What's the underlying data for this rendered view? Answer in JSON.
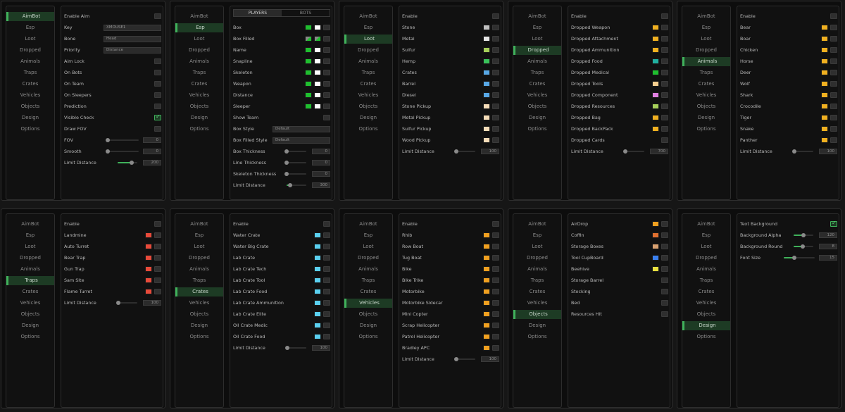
{
  "nav_labels": [
    "AimBot",
    "Esp",
    "Loot",
    "Dropped",
    "Animals",
    "Traps",
    "Crates",
    "Vehicles",
    "Objects",
    "Design",
    "Options"
  ],
  "esp_tabs": [
    "PLAYERS",
    "BOTS"
  ],
  "colors": {
    "accent": "#3fb25a",
    "bg": "#0d0d0d",
    "panel": "#111111"
  },
  "windows": [
    {
      "active": 0,
      "rows": [
        {
          "t": "check",
          "label": "Enable Aim",
          "on": false
        },
        {
          "t": "field",
          "label": "Key",
          "value": "XMOUSE1"
        },
        {
          "t": "field",
          "label": "Bone",
          "value": "Head"
        },
        {
          "t": "field",
          "label": "Priority",
          "value": "Distance"
        },
        {
          "t": "check",
          "label": "Aim Lock",
          "on": false
        },
        {
          "t": "check",
          "label": "On Bots",
          "on": false
        },
        {
          "t": "check",
          "label": "On Team",
          "on": false
        },
        {
          "t": "check",
          "label": "On Sleepers",
          "on": false
        },
        {
          "t": "check",
          "label": "Prediction",
          "on": false
        },
        {
          "t": "check",
          "label": "Visible Check",
          "on": true
        },
        {
          "t": "check",
          "label": "Draw FOV",
          "on": false
        },
        {
          "t": "slider",
          "label": "FOV",
          "value": "0",
          "pct": 0
        },
        {
          "t": "slider",
          "label": "Smooth",
          "value": "0",
          "pct": 0
        },
        {
          "t": "slider",
          "label": "Limit Distance",
          "value": "200",
          "pct": 0.72
        }
      ]
    },
    {
      "active": 1,
      "tabs": true,
      "rows": [
        {
          "t": "esp",
          "label": "Box",
          "colors": [
            "#1fbf2f",
            "#ffffff"
          ]
        },
        {
          "t": "esp",
          "label": "Box Filled",
          "colors": [
            "mixed",
            "mixed"
          ]
        },
        {
          "t": "esp",
          "label": "Name",
          "colors": [
            "#1fbf2f",
            "#ffffff"
          ]
        },
        {
          "t": "esp",
          "label": "Snapline",
          "colors": [
            "#1fbf2f",
            "#ffffff"
          ]
        },
        {
          "t": "esp",
          "label": "Skeleton",
          "colors": [
            "#1fbf2f",
            "#ffffff"
          ]
        },
        {
          "t": "esp",
          "label": "Weapon",
          "colors": [
            "#1fbf2f",
            "#ffffff"
          ]
        },
        {
          "t": "esp",
          "label": "Distance",
          "colors": [
            "#1fbf2f",
            "#ffffff"
          ]
        },
        {
          "t": "esp",
          "label": "Sleeper",
          "colors": [
            "#1fbf2f",
            "#ffffff"
          ]
        },
        {
          "t": "check",
          "label": "Show Team",
          "on": false
        },
        {
          "t": "field",
          "label": "Box Style",
          "value": "Default"
        },
        {
          "t": "field",
          "label": "Box Filled Style",
          "value": "Default"
        },
        {
          "t": "slider",
          "label": "Box Thickness",
          "value": "0",
          "pct": 0
        },
        {
          "t": "slider",
          "label": "Line Thickness",
          "value": "0",
          "pct": 0
        },
        {
          "t": "slider",
          "label": "Skeleton Thickness",
          "value": "0",
          "pct": 0
        },
        {
          "t": "slider",
          "label": "Limit Distance",
          "value": "300",
          "pct": 0.18
        }
      ]
    },
    {
      "active": 2,
      "rows": [
        {
          "t": "check",
          "label": "Enable",
          "on": false
        },
        {
          "t": "color",
          "label": "Stone",
          "color": "#c0c0c0"
        },
        {
          "t": "color",
          "label": "Metal",
          "color": "#e6e6e6"
        },
        {
          "t": "color",
          "label": "Sulfur",
          "color": "#a6cf5a"
        },
        {
          "t": "color",
          "label": "Hemp",
          "color": "#39c25a"
        },
        {
          "t": "color",
          "label": "Crates",
          "color": "#58a8e6"
        },
        {
          "t": "color",
          "label": "Barrel",
          "color": "#58a8e6"
        },
        {
          "t": "color",
          "label": "Diesel",
          "color": "#58a8e6"
        },
        {
          "t": "color",
          "label": "Stone Pickup",
          "color": "#f5dcb8"
        },
        {
          "t": "color",
          "label": "Metal Pickup",
          "color": "#f5dcb8"
        },
        {
          "t": "color",
          "label": "Sulfur Pickup",
          "color": "#f5dcb8"
        },
        {
          "t": "color",
          "label": "Wood Pickup",
          "color": "#f5dcb8"
        },
        {
          "t": "slider",
          "label": "Limit Distance",
          "value": "100",
          "pct": 0.05
        }
      ]
    },
    {
      "active": 3,
      "rows": [
        {
          "t": "check",
          "label": "Enable",
          "on": false
        },
        {
          "t": "color",
          "label": "Dropped Weapon",
          "color": "#f0b020"
        },
        {
          "t": "color",
          "label": "Dropped Attachment",
          "color": "#f0b020"
        },
        {
          "t": "color",
          "label": "Dropped Ammunition",
          "color": "#f0b020"
        },
        {
          "t": "color",
          "label": "Dropped Food",
          "color": "#20b0a0"
        },
        {
          "t": "color",
          "label": "Dropped Medical",
          "color": "#1fbf2f"
        },
        {
          "t": "color",
          "label": "Dropped Tools",
          "color": "#f5cf90"
        },
        {
          "t": "color",
          "label": "Dropped Component",
          "color": "#e080e0"
        },
        {
          "t": "color",
          "label": "Dropped Resources",
          "color": "#a6cf5a"
        },
        {
          "t": "color",
          "label": "Dropped Bag",
          "color": "#f0b020"
        },
        {
          "t": "color",
          "label": "Dropped BackPack",
          "color": "#f0b020"
        },
        {
          "t": "check",
          "label": "Dropped Cards",
          "on": false
        },
        {
          "t": "slider",
          "label": "Limit Distance",
          "value": "700",
          "pct": 0.05
        }
      ]
    },
    {
      "active": 4,
      "rows": [
        {
          "t": "check",
          "label": "Enable",
          "on": false
        },
        {
          "t": "color",
          "label": "Bear",
          "color": "#f0b020"
        },
        {
          "t": "color",
          "label": "Boar",
          "color": "#f0b020"
        },
        {
          "t": "color",
          "label": "Chicken",
          "color": "#f0b020"
        },
        {
          "t": "color",
          "label": "Horse",
          "color": "#f0b020"
        },
        {
          "t": "color",
          "label": "Deer",
          "color": "#f0b020"
        },
        {
          "t": "color",
          "label": "Wolf",
          "color": "#f0b020"
        },
        {
          "t": "color",
          "label": "Shark",
          "color": "#f0b020"
        },
        {
          "t": "color",
          "label": "Crocodile",
          "color": "#f0b020"
        },
        {
          "t": "color",
          "label": "Tiger",
          "color": "#f0b020"
        },
        {
          "t": "color",
          "label": "Snake",
          "color": "#f0b020"
        },
        {
          "t": "color",
          "label": "Panther",
          "color": "#f0b020"
        },
        {
          "t": "slider",
          "label": "Limit Distance",
          "value": "100",
          "pct": 0.05
        }
      ]
    },
    {
      "active": 5,
      "rows": [
        {
          "t": "check",
          "label": "Enable",
          "on": false
        },
        {
          "t": "color",
          "label": "Landmine",
          "color": "#e84a3a"
        },
        {
          "t": "color",
          "label": "Auto Turret",
          "color": "#e84a3a"
        },
        {
          "t": "color",
          "label": "Bear Trap",
          "color": "#e84a3a"
        },
        {
          "t": "color",
          "label": "Gun Trap",
          "color": "#e84a3a"
        },
        {
          "t": "color",
          "label": "Sam Site",
          "color": "#e84a3a"
        },
        {
          "t": "color",
          "label": "Flame Turret",
          "color": "#e84a3a"
        },
        {
          "t": "slider",
          "label": "Limit Distance",
          "value": "100",
          "pct": 0.05
        }
      ]
    },
    {
      "active": 6,
      "rows": [
        {
          "t": "check",
          "label": "Enable",
          "on": false
        },
        {
          "t": "color",
          "label": "Water Crate",
          "color": "#5ad0f0"
        },
        {
          "t": "color",
          "label": "Water Big Crate",
          "color": "#5ad0f0"
        },
        {
          "t": "color",
          "label": "Lab Crate",
          "color": "#5ad0f0"
        },
        {
          "t": "color",
          "label": "Lab Crate Tech",
          "color": "#5ad0f0"
        },
        {
          "t": "color",
          "label": "Lab Crate Tool",
          "color": "#5ad0f0"
        },
        {
          "t": "color",
          "label": "Lab Crate Food",
          "color": "#5ad0f0"
        },
        {
          "t": "color",
          "label": "Lab Crate Ammunition",
          "color": "#5ad0f0"
        },
        {
          "t": "color",
          "label": "Lab Crate Elite",
          "color": "#5ad0f0"
        },
        {
          "t": "color",
          "label": "Oil Crate Medic",
          "color": "#5ad0f0"
        },
        {
          "t": "color",
          "label": "Oil Crate Food",
          "color": "#5ad0f0"
        },
        {
          "t": "slider",
          "label": "Limit Distance",
          "value": "100",
          "pct": 0.05
        }
      ]
    },
    {
      "active": 7,
      "rows": [
        {
          "t": "check",
          "label": "Enable",
          "on": false
        },
        {
          "t": "color",
          "label": "Rhib",
          "color": "#f0a020"
        },
        {
          "t": "color",
          "label": "Row Boat",
          "color": "#f0a020"
        },
        {
          "t": "color",
          "label": "Tug Boat",
          "color": "#f0a020"
        },
        {
          "t": "color",
          "label": "Bike",
          "color": "#f0a020"
        },
        {
          "t": "color",
          "label": "Bike Trike",
          "color": "#f0a020"
        },
        {
          "t": "color",
          "label": "Motorbike",
          "color": "#f0a020"
        },
        {
          "t": "color",
          "label": "Motorbike Sidecar",
          "color": "#f0a020"
        },
        {
          "t": "color",
          "label": "Mini Copter",
          "color": "#f0a020"
        },
        {
          "t": "color",
          "label": "Scrap Helicopter",
          "color": "#f0a020"
        },
        {
          "t": "color",
          "label": "Patrol Helicopter",
          "color": "#f0a020"
        },
        {
          "t": "color",
          "label": "Bradley APC",
          "color": "#f0a020"
        },
        {
          "t": "slider",
          "label": "Limit Distance",
          "value": "100",
          "pct": 0.05
        }
      ]
    },
    {
      "active": 8,
      "rows": [
        {
          "t": "color",
          "label": "AirDrop",
          "color": "#f0a020"
        },
        {
          "t": "color",
          "label": "Coffin",
          "color": "#e07030"
        },
        {
          "t": "color",
          "label": "Storage Boxes",
          "color": "#d8a070"
        },
        {
          "t": "color",
          "label": "Tool CupBoard",
          "color": "#3a80f0"
        },
        {
          "t": "color",
          "label": "Beehive",
          "color": "#e8e040"
        },
        {
          "t": "check",
          "label": "Storage Barrel",
          "on": false
        },
        {
          "t": "check",
          "label": "Stocking",
          "on": false
        },
        {
          "t": "check",
          "label": "Bed",
          "on": false
        },
        {
          "t": "check",
          "label": "Resources Hit",
          "on": false
        }
      ]
    },
    {
      "active": 9,
      "rows": [
        {
          "t": "check",
          "label": "Text Background",
          "on": true
        },
        {
          "t": "slider",
          "label": "Background Alpha",
          "value": "120",
          "pct": 0.5
        },
        {
          "t": "slider",
          "label": "Background Round",
          "value": "8",
          "pct": 0.45
        },
        {
          "t": "slider",
          "label": "Font Size",
          "value": "15",
          "pct": 0.35
        }
      ]
    }
  ]
}
